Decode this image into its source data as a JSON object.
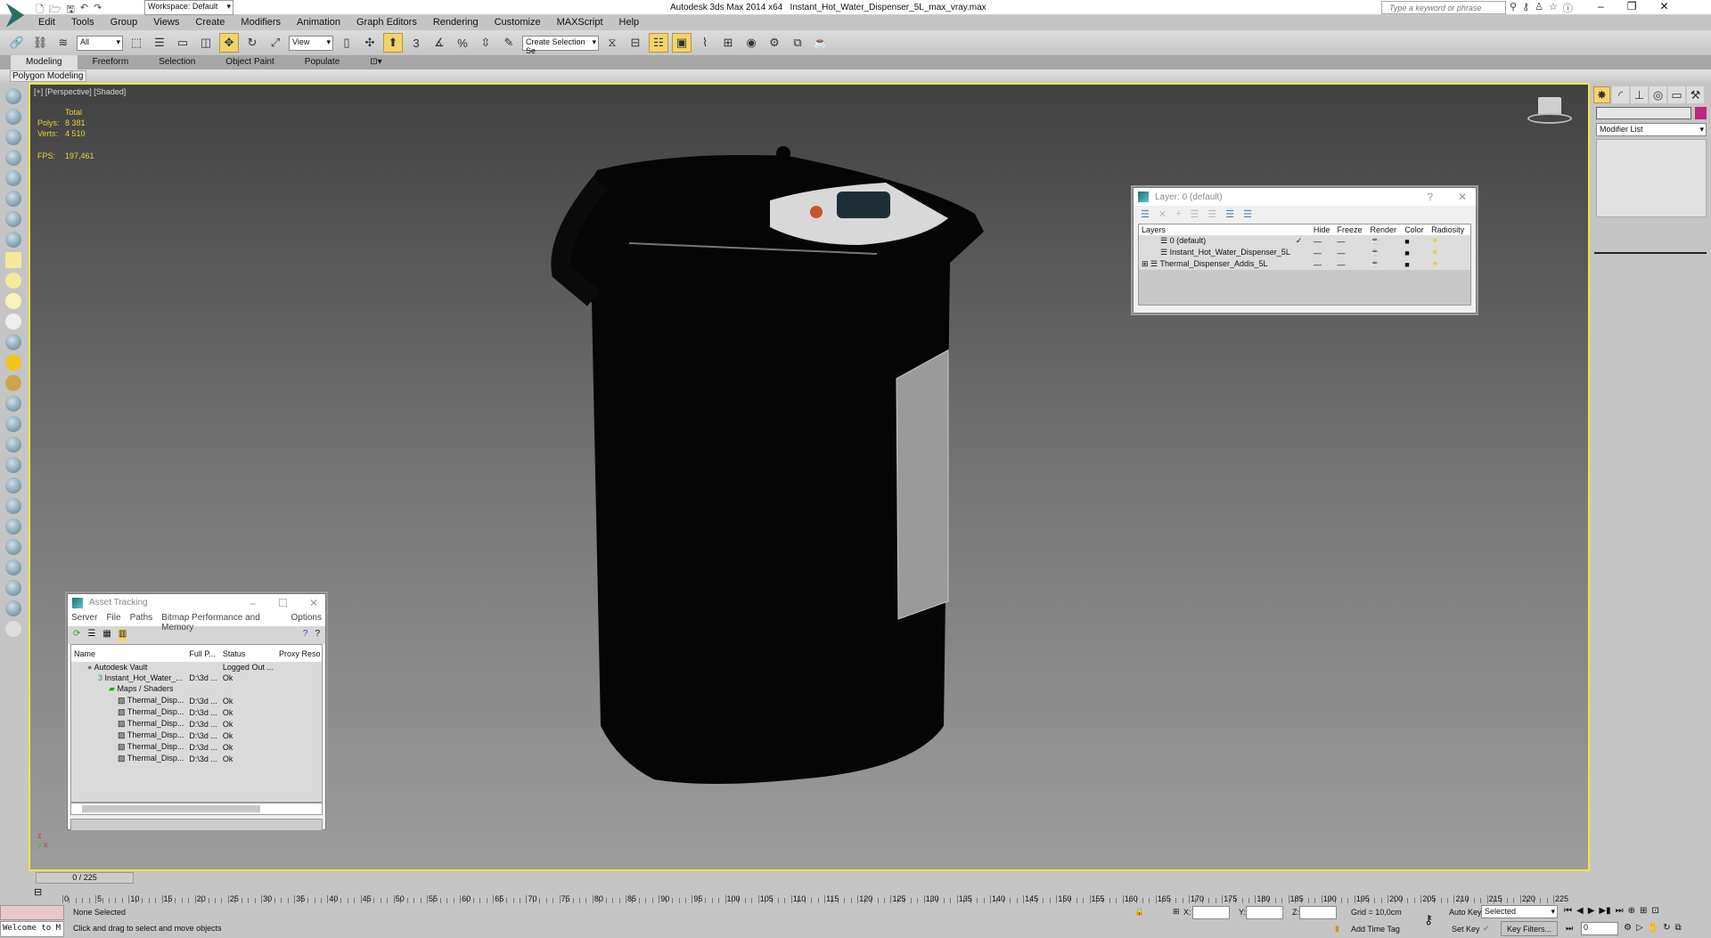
{
  "titlebar": {
    "workspace": "Workspace: Default",
    "app": "Autodesk 3ds Max  2014 x64",
    "file": "Instant_Hot_Water_Dispenser_5L_max_vray.max",
    "search_placeholder": "Type a keyword or phrase"
  },
  "menu": [
    "Edit",
    "Tools",
    "Group",
    "Views",
    "Create",
    "Modifiers",
    "Animation",
    "Graph Editors",
    "Rendering",
    "Customize",
    "MAXScript",
    "Help"
  ],
  "toolbar": {
    "filter": "All",
    "ref_coord": "View",
    "selection_set": "Create Selection Se",
    "snap_angle": "3",
    "snap_percent": "%"
  },
  "ribbon": {
    "tabs": [
      "Modeling",
      "Freeform",
      "Selection",
      "Object Paint",
      "Populate"
    ],
    "active": "Modeling",
    "panel": "Polygon Modeling"
  },
  "viewport": {
    "label": "[+] [Perspective] [Shaded]",
    "stats": {
      "header": "Total",
      "polys_label": "Polys:",
      "polys": "8 381",
      "verts_label": "Verts:",
      "verts": "4 510",
      "fps_label": "FPS:",
      "fps": "197,461"
    }
  },
  "layer_dialog": {
    "title": "Layer: 0 (default)",
    "columns": [
      "Layers",
      "",
      "Hide",
      "Freeze",
      "Render",
      "Color",
      "Radiosity"
    ],
    "rows": [
      {
        "name": "0 (default)",
        "current": "✓"
      },
      {
        "name": "Instant_Hot_Water_Dispenser_5L",
        "current": ""
      },
      {
        "name": "Thermal_Dispenser_Addis_5L",
        "current": "",
        "expand": "⊞"
      }
    ]
  },
  "asset_tracking": {
    "title": "Asset Tracking",
    "menu": [
      "Server",
      "File",
      "Paths",
      "Bitmap Performance and Memory",
      "Options"
    ],
    "columns": [
      "Name",
      "Full P...",
      "Status",
      "Proxy Reso"
    ],
    "rows": [
      {
        "name": "Autodesk Vault",
        "path": "",
        "status": "Logged Out ..."
      },
      {
        "name": "Instant_Hot_Water_...",
        "path": "D:\\3d ...",
        "status": "Ok"
      },
      {
        "name": "Maps / Shaders",
        "path": "",
        "status": ""
      },
      {
        "name": "Thermal_Disp...",
        "path": "D:\\3d ...",
        "status": "Ok"
      },
      {
        "name": "Thermal_Disp...",
        "path": "D:\\3d ...",
        "status": "Ok"
      },
      {
        "name": "Thermal_Disp...",
        "path": "D:\\3d ...",
        "status": "Ok"
      },
      {
        "name": "Thermal_Disp...",
        "path": "D:\\3d ...",
        "status": "Ok"
      },
      {
        "name": "Thermal_Disp...",
        "path": "D:\\3d ...",
        "status": "Ok"
      },
      {
        "name": "Thermal_Disp...",
        "path": "D:\\3d ...",
        "status": "Ok"
      }
    ]
  },
  "command_panel": {
    "modifier_list": "Modifier List",
    "color_swatch": "#c2257e"
  },
  "timeline": {
    "frame": "0 / 225",
    "ticks": [
      0,
      5,
      10,
      15,
      20,
      25,
      30,
      35,
      40,
      45,
      50,
      55,
      60,
      65,
      70,
      75,
      80,
      85,
      90,
      95,
      100,
      105,
      110,
      115,
      120,
      125,
      130,
      135,
      140,
      145,
      150,
      155,
      160,
      165,
      170,
      175,
      180,
      185,
      190,
      195,
      200,
      205,
      210,
      215,
      220,
      225
    ]
  },
  "status": {
    "maxscript": "Welcome to M",
    "selection": "None Selected",
    "prompt": "Click and drag to select and move objects",
    "x_label": "X:",
    "y_label": "Y:",
    "z_label": "Z:",
    "grid": "Grid = 10,0cm",
    "add_time_tag": "Add Time Tag",
    "auto_key": "Auto Key",
    "set_key": "Set Key",
    "key_mode": "Selected",
    "key_filters": "Key Filters...",
    "current_frame": "0"
  }
}
